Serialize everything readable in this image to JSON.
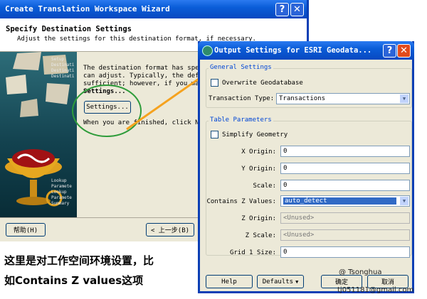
{
  "wizard": {
    "title": "Create Translation Workspace Wizard",
    "heading": "Specify Destination Settings",
    "subheading": "Adjust the settings for this destination format, if necessary.",
    "sidebar_items": [
      "Setup",
      "Destinati",
      "Destinati",
      "Destinati",
      "Lookup",
      "Paramete",
      "Lookup",
      "Paramete",
      "Summary"
    ],
    "body_line1": "The destination format has spe",
    "body_line2": "can adjust. Typically, the def",
    "body_line3": "sufficient; however, if you wa",
    "body_line4": "Settings...",
    "settings_button": "Settings...",
    "finished_text": "When you are finished, click N",
    "help_button": "帮助(H)",
    "back_button": "< 上一步(B)"
  },
  "dialog": {
    "title": "Output Settings for ESRI Geodata...",
    "general_group": "General Settings",
    "overwrite_label": "Overwrite Geodatabase",
    "transaction_type_label": "Transaction Type:",
    "transaction_type_value": "Transactions",
    "table_group": "Table Parameters",
    "simplify_label": "Simplify Geometry",
    "x_origin_label": "X Origin:",
    "x_origin_value": "0",
    "y_origin_label": "Y Origin:",
    "y_origin_value": "0",
    "scale_label": "Scale:",
    "scale_value": "0",
    "contains_z_label": "Contains Z Values:",
    "contains_z_value": "auto_detect",
    "z_origin_label": "Z Origin:",
    "z_origin_value": "<Unused>",
    "z_scale_label": "Z Scale:",
    "z_scale_value": "<Unused>",
    "grid_label": "Grid 1 Size:",
    "grid_value": "0",
    "help_button": "Help",
    "defaults_button": "Defaults",
    "ok_button": "确定",
    "cancel_button": "取消"
  },
  "caption": {
    "line1": "这里是对工作空间环境设置，比",
    "line2": "如Contains Z values这项"
  },
  "watermark": {
    "line1": "@ Tsonghua",
    "line2": "tj051181@gmail.com"
  },
  "colors": {
    "title_blue": "#0a5dd8",
    "window_bg": "#ece9d8",
    "arrow": "#f5a21e",
    "circle": "#2e9c3a",
    "selected": "#316ac5"
  }
}
